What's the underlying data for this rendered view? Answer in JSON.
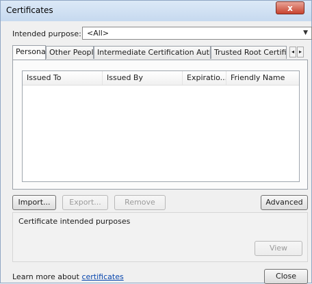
{
  "window": {
    "title": "Certificates",
    "close_glyph": "x"
  },
  "purpose": {
    "label": "Intended purpose:",
    "selected": "<All>",
    "arrow_glyph": "▼"
  },
  "tabs": [
    {
      "label": "Personal",
      "active": true
    },
    {
      "label": "Other People",
      "active": false
    },
    {
      "label": "Intermediate Certification Authorities",
      "active": false
    },
    {
      "label": "Trusted Root Certification",
      "active": false
    }
  ],
  "tab_scroll": {
    "left_glyph": "◂",
    "right_glyph": "▸"
  },
  "list": {
    "columns": [
      "Issued To",
      "Issued By",
      "Expiratio...",
      "Friendly Name"
    ]
  },
  "buttons": {
    "import": "Import...",
    "export": "Export...",
    "remove": "Remove",
    "advanced": "Advanced",
    "view": "View",
    "close": "Close"
  },
  "purposes_group": {
    "label": "Certificate intended purposes"
  },
  "learn_more": {
    "text": "Learn more about ",
    "link": "certificates"
  }
}
